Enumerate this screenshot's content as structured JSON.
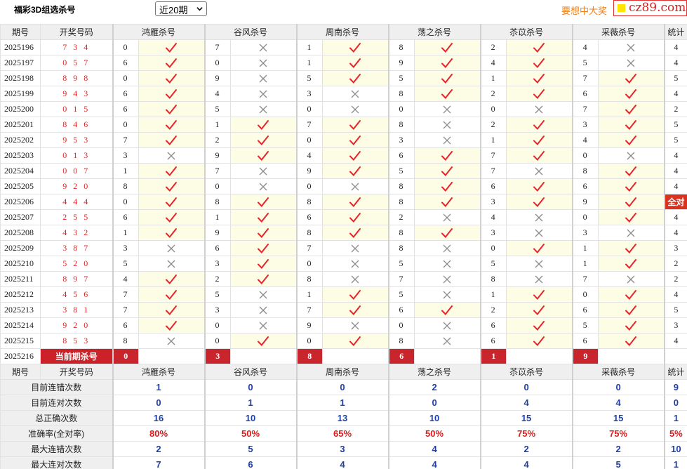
{
  "header": {
    "title": "福彩3D组选杀号",
    "select_value": "近20期",
    "promo": "要想中大奖",
    "site": "cz89.com"
  },
  "columns": {
    "period": "期号",
    "draw": "开奖号码",
    "methods": [
      "鸿雁杀号",
      "谷风杀号",
      "周南杀号",
      "荡之杀号",
      "苶苡杀号",
      "采薇杀号"
    ],
    "count": "统计"
  },
  "rows": [
    {
      "period": "2025196",
      "draw": "7 3 4",
      "kills": [
        "0",
        "7",
        "1",
        "8",
        "2",
        "4"
      ],
      "hits": [
        true,
        false,
        true,
        true,
        true,
        false
      ],
      "count": "4"
    },
    {
      "period": "2025197",
      "draw": "0 5 7",
      "kills": [
        "6",
        "0",
        "1",
        "9",
        "4",
        "5"
      ],
      "hits": [
        true,
        false,
        true,
        true,
        true,
        false
      ],
      "count": "4"
    },
    {
      "period": "2025198",
      "draw": "8 9 8",
      "kills": [
        "0",
        "9",
        "5",
        "5",
        "1",
        "7"
      ],
      "hits": [
        true,
        false,
        true,
        true,
        true,
        true
      ],
      "count": "5"
    },
    {
      "period": "2025199",
      "draw": "9 4 3",
      "kills": [
        "6",
        "4",
        "3",
        "8",
        "2",
        "6"
      ],
      "hits": [
        true,
        false,
        false,
        true,
        true,
        true
      ],
      "count": "4"
    },
    {
      "period": "2025200",
      "draw": "0 1 5",
      "kills": [
        "6",
        "5",
        "0",
        "0",
        "0",
        "7"
      ],
      "hits": [
        true,
        false,
        false,
        false,
        false,
        true
      ],
      "count": "2"
    },
    {
      "period": "2025201",
      "draw": "8 4 6",
      "kills": [
        "0",
        "1",
        "7",
        "8",
        "2",
        "3"
      ],
      "hits": [
        true,
        true,
        true,
        false,
        true,
        true
      ],
      "count": "5"
    },
    {
      "period": "2025202",
      "draw": "9 5 3",
      "kills": [
        "7",
        "2",
        "0",
        "3",
        "1",
        "4"
      ],
      "hits": [
        true,
        true,
        true,
        false,
        true,
        true
      ],
      "count": "5"
    },
    {
      "period": "2025203",
      "draw": "0 1 3",
      "kills": [
        "3",
        "9",
        "4",
        "6",
        "7",
        "0"
      ],
      "hits": [
        false,
        true,
        true,
        true,
        true,
        false
      ],
      "count": "4"
    },
    {
      "period": "2025204",
      "draw": "0 0 7",
      "kills": [
        "1",
        "7",
        "9",
        "5",
        "7",
        "8"
      ],
      "hits": [
        true,
        false,
        true,
        true,
        false,
        true
      ],
      "count": "4"
    },
    {
      "period": "2025205",
      "draw": "9 2 0",
      "kills": [
        "8",
        "0",
        "0",
        "8",
        "6",
        "6"
      ],
      "hits": [
        true,
        false,
        false,
        true,
        true,
        true
      ],
      "count": "4"
    },
    {
      "period": "2025206",
      "draw": "4 4 4",
      "kills": [
        "0",
        "8",
        "8",
        "8",
        "3",
        "9"
      ],
      "hits": [
        true,
        true,
        true,
        true,
        true,
        true
      ],
      "count": "全对"
    },
    {
      "period": "2025207",
      "draw": "2 5 5",
      "kills": [
        "6",
        "1",
        "6",
        "2",
        "4",
        "0"
      ],
      "hits": [
        true,
        true,
        true,
        false,
        false,
        true
      ],
      "count": "4"
    },
    {
      "period": "2025208",
      "draw": "4 3 2",
      "kills": [
        "1",
        "9",
        "8",
        "8",
        "3",
        "3"
      ],
      "hits": [
        true,
        true,
        true,
        true,
        false,
        false
      ],
      "count": "4"
    },
    {
      "period": "2025209",
      "draw": "3 8 7",
      "kills": [
        "3",
        "6",
        "7",
        "8",
        "0",
        "1"
      ],
      "hits": [
        false,
        true,
        false,
        false,
        true,
        true
      ],
      "count": "3"
    },
    {
      "period": "2025210",
      "draw": "5 2 0",
      "kills": [
        "5",
        "3",
        "0",
        "5",
        "5",
        "1"
      ],
      "hits": [
        false,
        true,
        false,
        false,
        false,
        true
      ],
      "count": "2"
    },
    {
      "period": "2025211",
      "draw": "8 9 7",
      "kills": [
        "4",
        "2",
        "8",
        "7",
        "8",
        "7"
      ],
      "hits": [
        true,
        true,
        false,
        false,
        false,
        false
      ],
      "count": "2"
    },
    {
      "period": "2025212",
      "draw": "4 5 6",
      "kills": [
        "7",
        "5",
        "1",
        "5",
        "1",
        "0"
      ],
      "hits": [
        true,
        false,
        true,
        false,
        true,
        true
      ],
      "count": "4"
    },
    {
      "period": "2025213",
      "draw": "3 8 1",
      "kills": [
        "7",
        "3",
        "7",
        "6",
        "2",
        "6"
      ],
      "hits": [
        true,
        false,
        true,
        true,
        true,
        true
      ],
      "count": "5"
    },
    {
      "period": "2025214",
      "draw": "9 2 0",
      "kills": [
        "6",
        "0",
        "9",
        "0",
        "6",
        "5"
      ],
      "hits": [
        true,
        false,
        false,
        false,
        true,
        true
      ],
      "count": "3"
    },
    {
      "period": "2025215",
      "draw": "8 5 3",
      "kills": [
        "8",
        "0",
        "0",
        "8",
        "6",
        "6"
      ],
      "hits": [
        false,
        true,
        true,
        false,
        true,
        true
      ],
      "count": "4"
    }
  ],
  "current": {
    "period": "2025216",
    "label": "当前期杀号",
    "kills": [
      "0",
      "3",
      "8",
      "6",
      "1",
      "9"
    ]
  },
  "stats": [
    {
      "label": "目前连错次数",
      "values": [
        "1",
        "0",
        "0",
        "2",
        "0",
        "0"
      ],
      "count": "9",
      "red": false
    },
    {
      "label": "目前连对次数",
      "values": [
        "0",
        "1",
        "1",
        "0",
        "4",
        "4"
      ],
      "count": "0",
      "red": false
    },
    {
      "label": "总正确次数",
      "values": [
        "16",
        "10",
        "13",
        "10",
        "15",
        "15"
      ],
      "count": "1",
      "red": false
    },
    {
      "label": "准确率(全对率)",
      "values": [
        "80%",
        "50%",
        "65%",
        "50%",
        "75%",
        "75%"
      ],
      "count": "5%",
      "red": true
    },
    {
      "label": "最大连错次数",
      "values": [
        "2",
        "5",
        "3",
        "4",
        "2",
        "2"
      ],
      "count": "10",
      "red": false
    },
    {
      "label": "最大连对次数",
      "values": [
        "7",
        "6",
        "4",
        "4",
        "4",
        "5"
      ],
      "count": "1",
      "red": false
    }
  ],
  "colors": {
    "hit": "#e8232b",
    "miss": "#8a8a8a",
    "accent": "#cc2128",
    "stat_blue": "#1f3fa8",
    "stat_red": "#e11a1a"
  },
  "icons": {
    "hit": "check-icon",
    "miss": "cross-icon"
  }
}
